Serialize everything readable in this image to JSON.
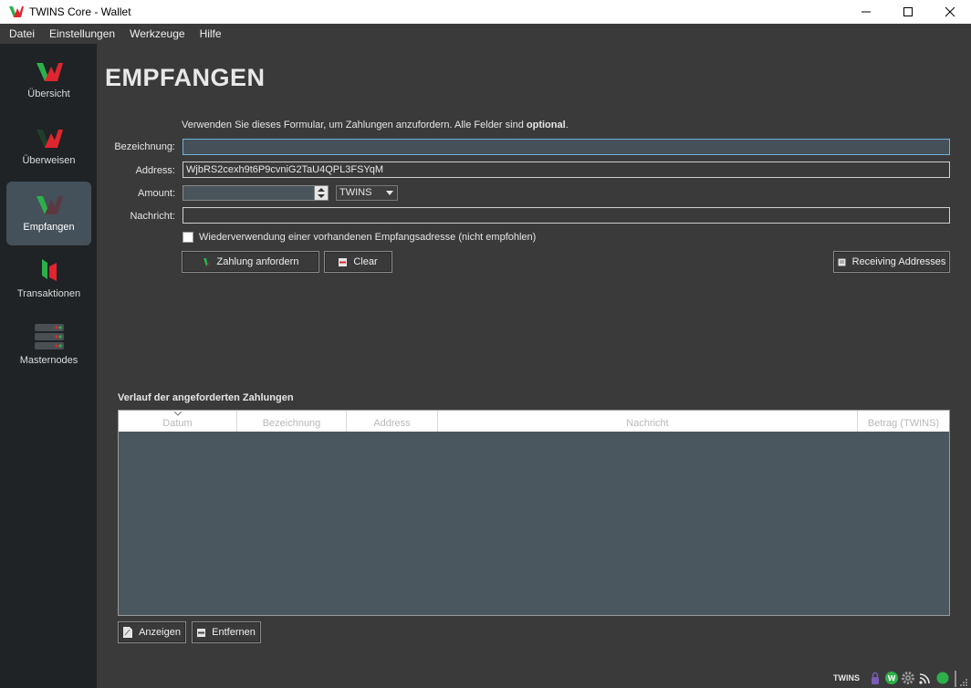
{
  "window": {
    "title": "TWINS Core - Wallet"
  },
  "menu": [
    "Datei",
    "Einstellungen",
    "Werkzeuge",
    "Hilfe"
  ],
  "sidebar": {
    "items": [
      {
        "label": "Übersicht",
        "icon": "twins-logo-icon"
      },
      {
        "label": "Überweisen",
        "icon": "send-icon"
      },
      {
        "label": "Empfangen",
        "icon": "receive-icon",
        "active": true
      },
      {
        "label": "Transaktionen",
        "icon": "transactions-icon"
      },
      {
        "label": "Masternodes",
        "icon": "masternodes-icon"
      }
    ]
  },
  "page": {
    "title": "EMPFANGEN",
    "hint_prefix": "Verwenden Sie dieses Formular, um Zahlungen anzufordern. Alle Felder sind ",
    "hint_bold": "optional",
    "hint_suffix": "."
  },
  "form": {
    "label_label": "Bezeichnung:",
    "label_value": "",
    "address_label": "Address:",
    "address_value": "WjbRS2cexh9t6P9cvniG2TaU4QPL3FSYqM",
    "amount_label": "Amount:",
    "amount_value": "",
    "unit": "TWINS",
    "message_label": "Nachricht:",
    "message_value": "",
    "reuse_label": "Wiederverwendung einer vorhandenen Empfangsadresse (nicht empfohlen)",
    "reuse_checked": false
  },
  "buttons": {
    "request": "Zahlung anfordern",
    "clear": "Clear",
    "receiving_addresses": "Receiving Addresses",
    "show": "Anzeigen",
    "remove": "Entfernen"
  },
  "history": {
    "title": "Verlauf der angeforderten Zahlungen",
    "columns": [
      "Datum",
      "Bezeichnung",
      "Address",
      "Nachricht",
      "Betrag (TWINS)"
    ],
    "rows": []
  },
  "statusbar": {
    "unit": "TWINS",
    "icons": [
      "lock-icon",
      "staking-icon",
      "gear-icon",
      "network-icon",
      "sync-status-icon"
    ]
  },
  "colors": {
    "accent_red": "#e0252e",
    "accent_green": "#2db04a",
    "sidebar_bg": "#1f2326",
    "active_item_bg": "#44505a"
  }
}
